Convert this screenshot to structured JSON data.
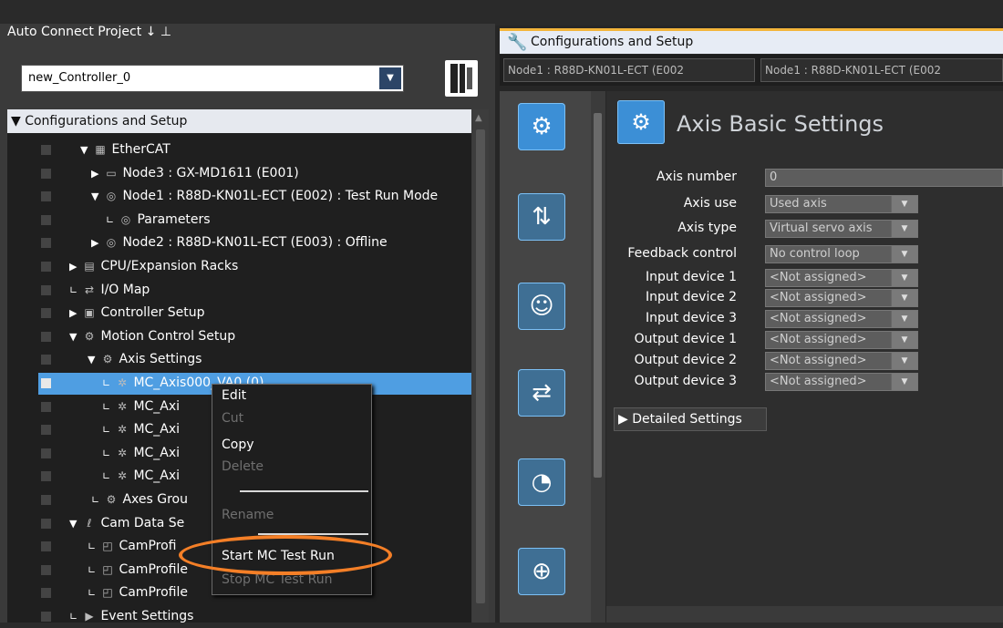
{
  "left_panel": {
    "title": "Auto Connect Project",
    "pin_icon": "↓ ⊥",
    "controller_select": "new_Controller_0",
    "tree_root": "Configurations and Setup",
    "tree": [
      {
        "label": "EtherCAT",
        "icon": "ethercat-icon",
        "toggle": "▼"
      },
      {
        "label": "Node3 : GX-MD1611 (E001)",
        "icon": "device-icon",
        "toggle": "▶"
      },
      {
        "label": "Node1 : R88D-KN01L-ECT (E002) : Test Run Mode",
        "icon": "servo-icon",
        "toggle": "▼"
      },
      {
        "label": "Parameters",
        "icon": "servo-icon",
        "toggle": "∟"
      },
      {
        "label": "Node2 : R88D-KN01L-ECT (E003) : Offline",
        "icon": "servo-icon",
        "toggle": "▶"
      },
      {
        "label": "CPU/Expansion Racks",
        "icon": "rack-icon",
        "toggle": "▶"
      },
      {
        "label": "I/O Map",
        "icon": "io-map-icon",
        "toggle": "∟"
      },
      {
        "label": "Controller Setup",
        "icon": "controller-icon",
        "toggle": "▶"
      },
      {
        "label": "Motion Control Setup",
        "icon": "gear-icon",
        "toggle": "▼"
      },
      {
        "label": "Axis Settings",
        "icon": "gear-icon",
        "toggle": "▼"
      },
      {
        "label": "MC_Axis000_VA0 (0)",
        "icon": "axis-icon",
        "toggle": "∟"
      },
      {
        "label": "MC_Axi",
        "icon": "axis-icon",
        "toggle": "∟"
      },
      {
        "label": "MC_Axi",
        "icon": "axis-icon",
        "toggle": "∟"
      },
      {
        "label": "MC_Axi",
        "icon": "axis-icon",
        "toggle": "∟"
      },
      {
        "label": "MC_Axi",
        "icon": "axis-icon",
        "toggle": "∟"
      },
      {
        "label": "Axes Grou",
        "icon": "axes-group-icon",
        "toggle": "∟"
      },
      {
        "label": "Cam Data Se",
        "icon": "cam-icon",
        "toggle": "▼"
      },
      {
        "label": "CamProfi",
        "icon": "cam-profile-icon",
        "toggle": "∟"
      },
      {
        "label": "CamProfile",
        "icon": "cam-profile-icon",
        "toggle": "∟"
      },
      {
        "label": "CamProfile",
        "icon": "cam-profile-icon",
        "toggle": "∟"
      },
      {
        "label": "Event Settings",
        "icon": "event-icon",
        "toggle": "∟"
      }
    ]
  },
  "context_menu": {
    "items": [
      {
        "label": "Edit",
        "enabled": true
      },
      {
        "label": "Cut",
        "enabled": false
      },
      {
        "label": "Copy",
        "enabled": true
      },
      {
        "label": "Delete",
        "enabled": false
      },
      {
        "label": "Rename",
        "enabled": false
      },
      {
        "label": "Start MC Test Run",
        "enabled": true
      },
      {
        "label": "Stop MC Test Run",
        "enabled": false
      }
    ],
    "highlight_color": "#f47f27"
  },
  "right_panel": {
    "window_title": "Configurations and Setup",
    "tabs": [
      "Node1 : R88D-KN01L-ECT (E002",
      "Node1 : R88D-KN01L-ECT (E002"
    ],
    "side_icons": [
      "axis-settings-icon",
      "units-icon",
      "operation-icon",
      "io-swap-icon",
      "speed-gauge-icon",
      "position-icon"
    ],
    "content_title": "Axis Basic Settings",
    "fields": [
      {
        "label": "Axis number",
        "value": "0",
        "dropdown": false
      },
      {
        "label": "Axis use",
        "value": "Used axis",
        "dropdown": true
      },
      {
        "label": "Axis type",
        "value": "Virtual servo axis",
        "dropdown": true
      },
      {
        "label": "Feedback control",
        "value": "No control loop",
        "dropdown": true
      },
      {
        "label": "Input device 1",
        "value": "<Not assigned>",
        "dropdown": true
      },
      {
        "label": "Input device 2",
        "value": "<Not assigned>",
        "dropdown": true
      },
      {
        "label": "Input device 3",
        "value": "<Not assigned>",
        "dropdown": true
      },
      {
        "label": "Output device 1",
        "value": "<Not assigned>",
        "dropdown": true
      },
      {
        "label": "Output device 2",
        "value": "<Not assigned>",
        "dropdown": true
      },
      {
        "label": "Output device 3",
        "value": "<Not assigned>",
        "dropdown": true
      }
    ],
    "detailed_settings": "Detailed Settings"
  },
  "colors": {
    "selection": "#4f9ee2",
    "accent_tab": "#f3b53a"
  }
}
